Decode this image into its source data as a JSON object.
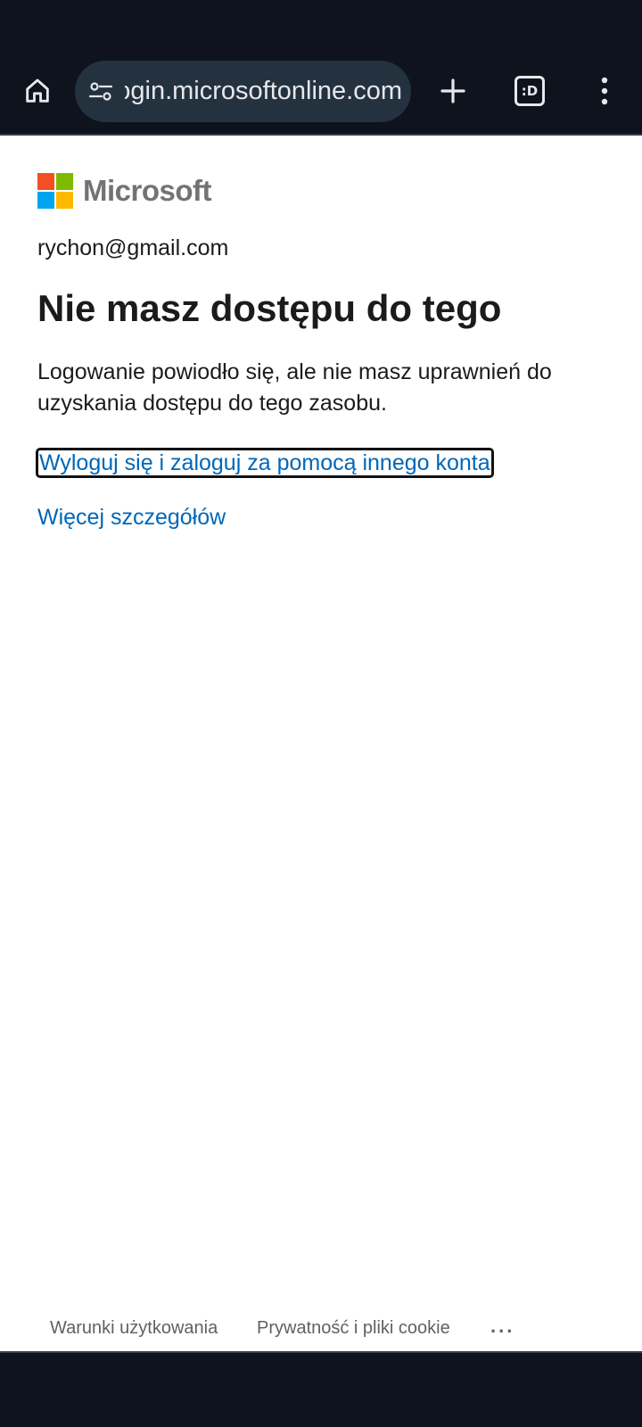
{
  "browser": {
    "url": "login.microsoftonline.com",
    "tabs_label": ":D",
    "colors": {
      "toolbar_bg": "#0f131d",
      "url_pill_bg": "#243240"
    }
  },
  "page": {
    "brand": "Microsoft",
    "account_email": "rychon@gmail.com",
    "title": "Nie masz dostępu do tego",
    "description": "Logowanie powiodło się, ale nie masz uprawnień do uzyskania dostępu do tego zasobu.",
    "signout_link": "Wyloguj się i zaloguj za pomocą innego konta",
    "details_link": "Więcej szczegółów",
    "link_color": "#0067b8"
  },
  "footer": {
    "terms": "Warunki użytkowania",
    "privacy": "Prywatność i pliki cookie",
    "more": "..."
  },
  "icons": [
    "home-icon",
    "site-info-icon",
    "plus-icon",
    "tabs-icon",
    "more-vert-icon"
  ]
}
